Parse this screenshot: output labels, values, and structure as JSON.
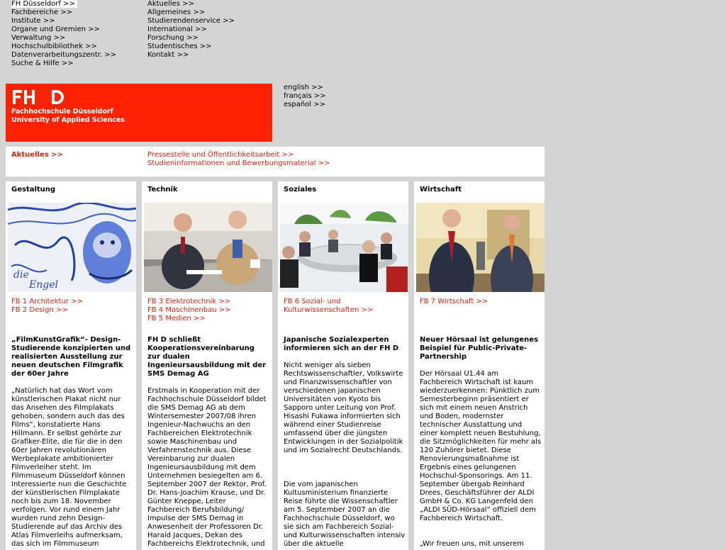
{
  "nav_left": [
    "FH Düsseldorf >>",
    "Fachbereiche >>",
    "Institute >>",
    "Organe und Gremien >>",
    "Verwaltung >>",
    "Hochschulbibliothek >>",
    "Datenverarbeitungszentr. >>",
    "Suche & Hilfe >>"
  ],
  "nav_right": [
    "Aktuelles >>",
    "Allgemeines >>",
    "Studierendenservice >>",
    "International >>",
    "Forschung >>",
    "Studentisches >>",
    "Kontakt >>"
  ],
  "logo": {
    "mark": "FH D",
    "line1": "Fachhochschule Düsseldorf",
    "line2": "University of Applied Sciences"
  },
  "languages": [
    "english >>",
    "français >>",
    "español >>"
  ],
  "newsbar": {
    "aktuelles": "Aktuelles >>",
    "links": [
      "Pressestelle und Öffentlichkeitsarbeit >>",
      "Studieninformationen und Bewerbungsmaterial >>"
    ]
  },
  "columns": [
    {
      "title": "Gestaltung",
      "links": [
        "FB 1 Architektur >>",
        "FB 2 Design >>"
      ],
      "headline": "„FilmKunstGrafik“- Design-Studierende konzipierten und realisierten Ausstellung zur neuen deutschen Filmgrafik der 60er Jahre",
      "body": "„Natürlich hat das Wort vom künstlerischen Plakat nicht nur das Ansehen des Filmplakats gehoben, sondern auch das des Films“, konstatierte Hans Hillmann. Er selbst gehörte zur Grafiker-Elite, die für die in den 60er Jahren revolutionären Werbeplakate ambitionierter Filmverleiher steht. Im Filmmuseum Düsseldorf können Interessierte nun die Geschichte der künstlerischen Filmplakate noch bis zum 18. November verfolgen. Vor rund einem Jahr wurden rund zehn Design-Studierende auf das Archiv des Atlas Filmverleihs aufmerksam, das sich im Filmmuseum"
    },
    {
      "title": "Technik",
      "links": [
        "FB 3 Elektrotechnik >>",
        "FB 4 Maschinenbau >>",
        "FB 5 Medien >>"
      ],
      "headline": "FH D schließt Kooperationsvereinbarung zur dualen Ingenieursausbildung mit der SMS Demag AG",
      "body": "Erstmals in Kooperation mit der Fachhochschule Düsseldorf bildet die SMS Demag AG ab dem Wintersemester 2007/08 ihren Ingenieur-Nachwuchs an den Fachbereichen Elektrotechnik sowie Maschinenbau und Verfahrenstechnik aus. Diese Vereinbarung zur dualen Ingenieursausbildung mit dem Unternehmen besiegelten am 6. September 2007 der Rektor, Prof. Dr. Hans-Joachim Krause, und Dr. Günter Kneppe, Leiter Fachbereich Berufsbildung/ Impulse der SMS Demag in Anwesenheit der Professoren Dr. Harald Jacques, Dekan des Fachbereichs Elektrotechnik, und"
    },
    {
      "title": "Soziales",
      "links": [
        "FB 6 Sozial- und",
        "Kulturwissenschaften >>"
      ],
      "headline": "Japanische Sozialexperten informieren sich an der FH D",
      "body": "Nicht weniger als sieben Rechtswissenschaftler, Volkswirte und Finanzwissenschaftler von verschiedenen japanischen Universitäten von Kyoto bis Sapporo unter Leitung von Prof. Hisashi Fukawa informierten sich während einer Studienreise umfassend über die jüngsten Entwicklungen in der Sozialpolitik und im Sozialrecht Deutschlands.",
      "body2": "Die vom japanischen Kultusministerium finanzierte Reise führte die Wissenschaftler am 5. September 2007 an die Fachhochschule Düsseldorf, wo sie sich am Fachbereich Sozial- und Kulturwissenschaften intensiv über die aktuelle"
    },
    {
      "title": "Wirtschaft",
      "links": [
        "FB 7 Wirtschaft >>"
      ],
      "headline": "Neuer Hörsaal ist gelungenes Beispiel für Public-Private-Partnership",
      "body": "Der Hörsaal U1.44 am Fachbereich Wirtschaft ist kaum wiederzuerkennen: Pünktlich zum Semesterbeginn präsentiert er sich mit einem neuen Anstrich und Boden, modernster technischer Ausstattung und einer komplett neuen Bestuhlung, die Sitzmöglichkeiten für mehr als 120 Zuhörer bietet. Diese Renovierungsmaßnahme ist Ergebnis eines gelungenen Hochschul-Sponsorings. Am 11. September übergab Reinhard Drees, Geschäftsführer der ALDI GmbH & Co. KG Langenfeld den „ALDI SÜD-Hörsaal“ offiziell dem Fachbereich Wirtschaft.",
      "body2": "„Wir freuen uns, mit unserem"
    }
  ],
  "colors": {
    "brand_red": "#ff2200",
    "link_red": "#e0200a",
    "page_bg": "#d4d4d4"
  }
}
